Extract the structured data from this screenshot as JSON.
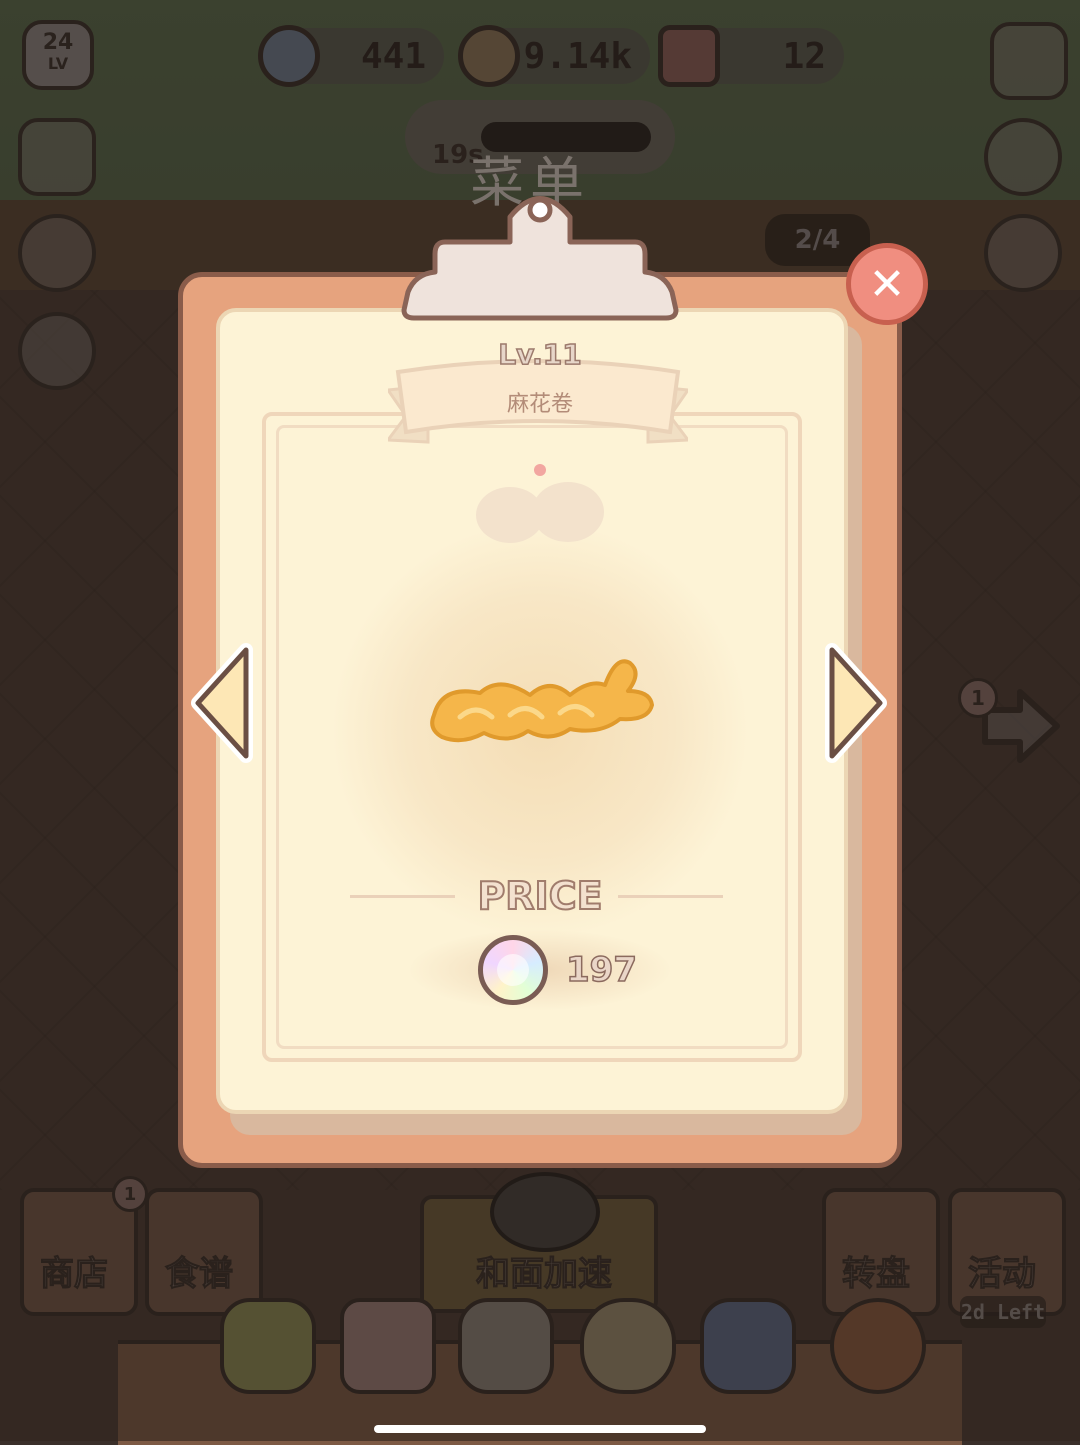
{
  "hud": {
    "level": "24",
    "level_suffix": "LV",
    "gems": "441",
    "coins": "9.14k",
    "tickets": "12",
    "timer": "19s",
    "title_bg": "菜单",
    "counter": "2/4",
    "nav_badge": "1"
  },
  "modal": {
    "level": "Lv.11",
    "dish_name": "麻花卷",
    "price_label": "PRICE",
    "price_value": "197",
    "close_symbol": "✕",
    "accent": "#f08e80",
    "paper": "#fdf3d6",
    "board": "#e6a37e"
  },
  "bottom": {
    "shop_label": "商店",
    "shop_badge": "1",
    "recipe_label": "食谱",
    "speedup_label": "和面加速",
    "wheel_label": "转盘",
    "event_label": "活动",
    "event_timer": "2d Left"
  }
}
